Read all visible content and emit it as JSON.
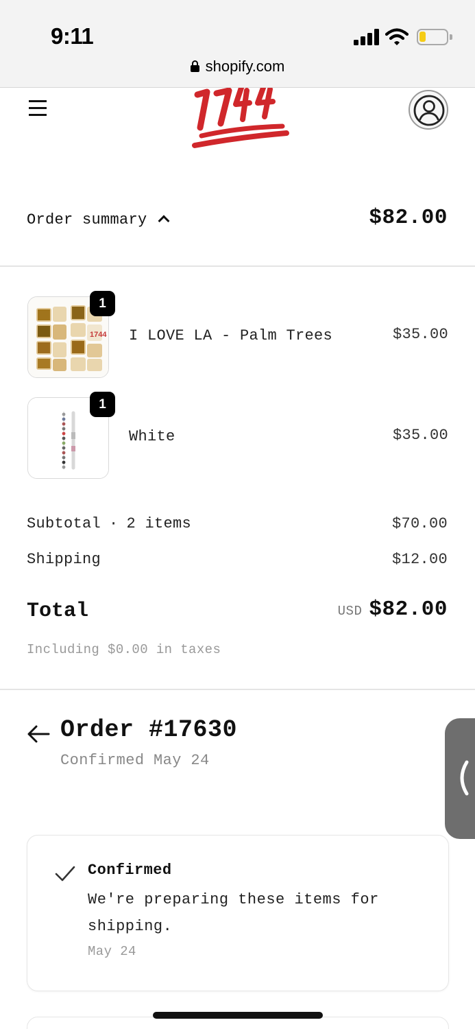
{
  "status_bar": {
    "time": "9:11",
    "url": "shopify.com",
    "battery_level": 0.25,
    "battery_color": "#f5cc16"
  },
  "header": {
    "menu_icon": "hamburger-menu-icon",
    "logo": "1744",
    "logo_color": "#d0272b",
    "account_icon": "user-account-icon"
  },
  "summary": {
    "toggle_label": "Order summary",
    "toggle_icon": "chevron-up-icon",
    "total": "$82.00"
  },
  "items": [
    {
      "name": "I LOVE LA - Palm Trees",
      "price": "$35.00",
      "quantity": "1",
      "image": "wooden-tile-bracelet"
    },
    {
      "name": "White",
      "price": "$35.00",
      "quantity": "1",
      "image": "white-beaded-bracelet"
    }
  ],
  "totals": {
    "subtotal_label": "Subtotal",
    "item_count": "2 items",
    "subtotal_value": "$70.00",
    "shipping_label": "Shipping",
    "shipping_value": "$12.00",
    "total_label": "Total",
    "currency": "USD",
    "total_value": "$82.00",
    "taxes_note": "Including $0.00 in taxes"
  },
  "order": {
    "title": "Order #17630",
    "subtitle": "Confirmed May 24",
    "back_icon": "arrow-left-icon",
    "side_tab_icon": "chevron-left-icon"
  },
  "status_card": {
    "icon": "check-icon",
    "title": "Confirmed",
    "description": "We're preparing these items for shipping.",
    "date": "May 24"
  }
}
